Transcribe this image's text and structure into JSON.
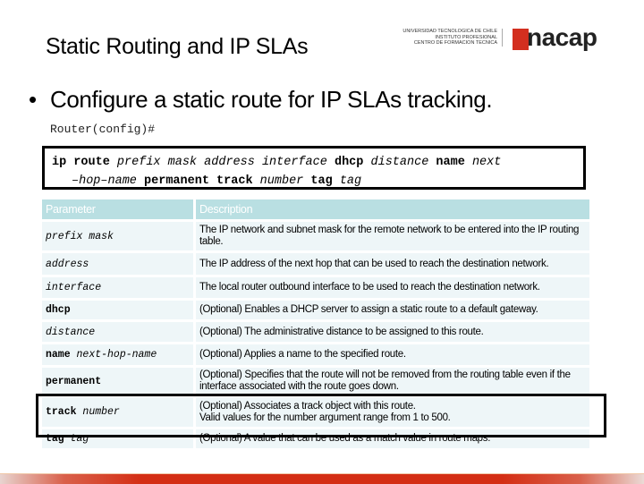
{
  "slide": {
    "title": "Static Routing and IP SLAs",
    "logo": {
      "institution_lines": [
        "UNIVERSIDAD TECNOLOGICA DE CHILE",
        "INSTITUTO PROFESIONAL",
        "CENTRO DE FORMACION TECNICA"
      ],
      "brand": "nacap",
      "brand_color": "#d32f1f"
    },
    "bullet": "Configure a static route for IP SLAs tracking.",
    "prompt": "Router(config)#",
    "command": {
      "line1": [
        {
          "text": "ip route",
          "style": "bold"
        },
        {
          "text": "prefix mask address interface",
          "style": "italic"
        },
        {
          "text": "dhcp",
          "style": "bold"
        },
        {
          "text": "distance",
          "style": "italic"
        },
        {
          "text": "name",
          "style": "bold"
        },
        {
          "text": "next",
          "style": "italic"
        }
      ],
      "line2": [
        {
          "text": "–hop–name",
          "style": "italic"
        },
        {
          "text": "permanent track",
          "style": "bold"
        },
        {
          "text": "number",
          "style": "italic"
        },
        {
          "text": "tag",
          "style": "bold"
        },
        {
          "text": "tag",
          "style": "italic"
        }
      ]
    },
    "table": {
      "headers": [
        "Parameter",
        "Description"
      ],
      "header_color": "#b9dfe2",
      "rows": [
        {
          "param": [
            {
              "text": "prefix mask",
              "style": "italic"
            }
          ],
          "desc": "The IP network and subnet mask for the remote network to be entered into the IP routing table."
        },
        {
          "param": [
            {
              "text": "address",
              "style": "italic"
            }
          ],
          "desc": "The IP address of the next hop that can be used to reach the destination network."
        },
        {
          "param": [
            {
              "text": "interface",
              "style": "italic"
            }
          ],
          "desc": "The local router outbound interface to be used to reach the destination network."
        },
        {
          "param": [
            {
              "text": "dhcp",
              "style": "bold"
            }
          ],
          "desc": "(Optional) Enables a DHCP server to assign a static route to a default gateway."
        },
        {
          "param": [
            {
              "text": "distance",
              "style": "italic"
            }
          ],
          "desc": "(Optional) The administrative distance to be assigned to this route."
        },
        {
          "param": [
            {
              "text": "name",
              "style": "bold"
            },
            {
              "text": "next-hop-name",
              "style": "italic"
            }
          ],
          "desc": "(Optional) Applies a name to the specified route."
        },
        {
          "param": [
            {
              "text": "permanent",
              "style": "bold"
            }
          ],
          "desc": "(Optional) Specifies that the route will not be removed from the routing table even if the interface associated with the route goes down."
        },
        {
          "param": [
            {
              "text": "track",
              "style": "bold"
            },
            {
              "text": "number",
              "style": "italic"
            }
          ],
          "desc": "(Optional) Associates a track object with this route.\nValid values for the number argument range from 1 to 500.",
          "highlighted": true
        },
        {
          "param": [
            {
              "text": "tag",
              "style": "bold"
            },
            {
              "text": "tag",
              "style": "italic"
            }
          ],
          "desc": "(Optional) A value that can be used as a match value in route maps."
        }
      ]
    },
    "footer_color": "#d42e14"
  }
}
